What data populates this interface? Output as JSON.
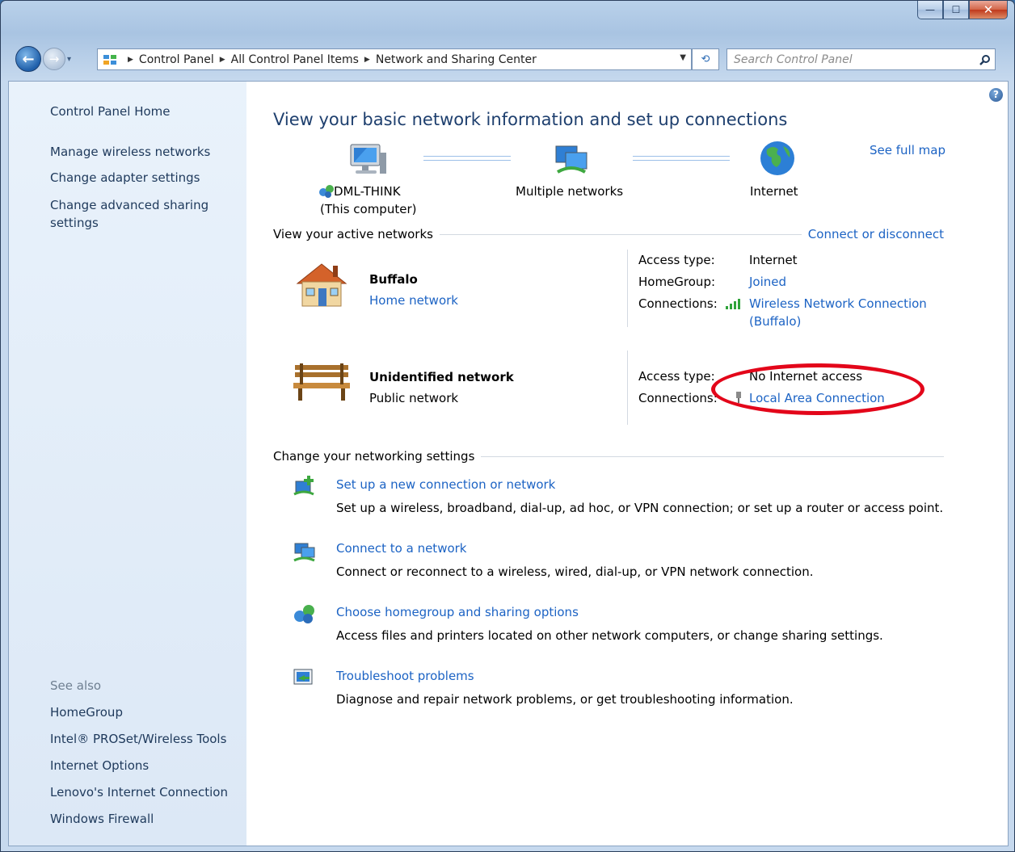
{
  "window": {
    "minimize_glyph": "—",
    "maximize_glyph": "☐",
    "close_glyph": "✕"
  },
  "nav": {
    "back_glyph": "←",
    "forward_glyph": "→",
    "breadcrumbs": [
      "Control Panel",
      "All Control Panel Items",
      "Network and Sharing Center"
    ],
    "search_placeholder": "Search Control Panel"
  },
  "sidebar": {
    "items": [
      "Control Panel Home",
      "Manage wireless networks",
      "Change adapter settings",
      "Change advanced sharing",
      "settings"
    ],
    "see_also_label": "See also",
    "see_also": [
      "HomeGroup",
      "Intel® PROSet/Wireless Tools",
      "Internet Options",
      "Lenovo's Internet Connection",
      "Windows Firewall"
    ]
  },
  "main": {
    "title": "View your basic network information and set up connections",
    "see_full_map": "See full map",
    "map": {
      "computer_name": "DML-THINK",
      "computer_sub": "(This computer)",
      "middle": "Multiple networks",
      "internet": "Internet"
    },
    "active_networks_label": "View your active networks",
    "connect_disconnect": "Connect or disconnect",
    "networks": [
      {
        "name": "Buffalo",
        "type": "Home network",
        "access_type_label": "Access type:",
        "access_type": "Internet",
        "homegroup_label": "HomeGroup:",
        "homegroup": "Joined",
        "connections_label": "Connections:",
        "connection_line1": "Wireless Network Connection",
        "connection_line2": "(Buffalo)"
      },
      {
        "name": "Unidentified network",
        "type": "Public network",
        "access_type_label": "Access type:",
        "access_type": "No Internet access",
        "connections_label": "Connections:",
        "connection_line1": "Local Area Connection"
      }
    ],
    "change_settings_label": "Change your networking settings",
    "tasks": [
      {
        "title": "Set up a new connection or network",
        "desc": "Set up a wireless, broadband, dial-up, ad hoc, or VPN connection; or set up a router or access point."
      },
      {
        "title": "Connect to a network",
        "desc": "Connect or reconnect to a wireless, wired, dial-up, or VPN network connection."
      },
      {
        "title": "Choose homegroup and sharing options",
        "desc": "Access files and printers located on other network computers, or change sharing settings."
      },
      {
        "title": "Troubleshoot problems",
        "desc": "Diagnose and repair network problems, or get troubleshooting information."
      }
    ]
  },
  "help_glyph": "?",
  "colors": {
    "link": "#1c63c4",
    "title": "#1e3f6e",
    "annotation": "#e3061a"
  }
}
